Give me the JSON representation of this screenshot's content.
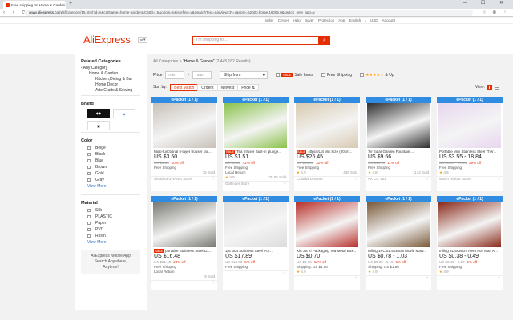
{
  "browser": {
    "tab_title": "Free shipping on Home & Garden",
    "url_host": "www.aliexpress.com",
    "url_rest": "/af/category/15.html?d=n&catName=home-garden&CatId=15&origin=n&isrefine=y&SearchText=&isViewCP=y&spm=a2g0o.home.16005.0&switch_new_app=y"
  },
  "topbar": {
    "links": "Seller Center    Help    Buyer Protection    App    English / USD    Account"
  },
  "header": {
    "logo": "AliExpress",
    "search_placeholder": "I'm shopping for..."
  },
  "sidebar": {
    "related_title": "Related Categories",
    "any_category": "Any Category",
    "home_garden": "Home & Garden",
    "sub1": "Kitchen,Dining & Bar",
    "sub2": "Home Decor",
    "sub3": "Arts,Crafts & Sewing",
    "brand_title": "Brand",
    "color_title": "Color",
    "colors": [
      "Beige",
      "Black",
      "Blue",
      "Brown",
      "Gold",
      "Gray"
    ],
    "view_more": "View More",
    "material_title": "Material",
    "materials": [
      "Silk",
      "PLASTIC",
      "Paper",
      "PVC",
      "Resin"
    ],
    "view_more2": "View More",
    "app_line1": "AliExpress Mobile App",
    "app_line2": "Search Anywhere,",
    "app_line3": "Anytime!"
  },
  "main": {
    "crumb_all": "All Categories",
    "crumb_sep": " > ",
    "crumb_cat": "\"Home & Garden\"",
    "crumb_count": " (2,445,162 Results)",
    "price_label": "Price",
    "min_placeholder": "min",
    "max_placeholder": "max",
    "ship_from": "Ship from",
    "sale_tag": "SALE",
    "sale_items": "Sale Items",
    "free_shipping": "Free Shipping",
    "and_up": "& Up",
    "sort_by": "Sort by:",
    "sort_best": "Best Match",
    "sort_orders": "Orders",
    "sort_newest": "Newest",
    "sort_price": "Price",
    "view_label": "View:"
  },
  "products": [
    {
      "badge": "ePacket (1 / 1)",
      "sale": false,
      "title": "Multi-functional 5-layer trouser rac...",
      "price": "US $3.50",
      "orig": "US $3.89",
      "off": "10% off",
      "ship": "Free Shipping",
      "local": "",
      "rating": "",
      "sold": "15 Sold",
      "store": "Shoebox-ZHANG Store",
      "sold2": "",
      "color": "#c8c0b8"
    },
    {
      "badge": "ePacket (1 / 1)",
      "sale": true,
      "title": "Tea Infuser Built-in plunge...",
      "price": "US $1.51",
      "orig": "US $2.61",
      "off": "42% off",
      "ship": "Free Shipping",
      "local": "Local Return",
      "rating": "4.9",
      "sold": "20105 Sold",
      "store": "Golfinder Store",
      "sold2": "",
      "color": "#8ac24a"
    },
    {
      "badge": "ePacket (1 / 1)",
      "sale": true,
      "title": "40pcs/Lot Mix Size (20cm...",
      "price": "US $26.45",
      "orig": "US $38.89",
      "off": "32% off",
      "ship": "Free Shipping",
      "local": "",
      "rating": "4.9",
      "sold": "439 Sold",
      "store": "Colorful Dreams",
      "sold2": "",
      "color": "#d8c9b0"
    },
    {
      "badge": "ePacket (1 / 1)",
      "sale": false,
      "title": "7V Solar Garden Fountain ...",
      "price": "US $9.66",
      "orig": "US $10.90",
      "off": "11% off",
      "ship": "Free Shipping",
      "local": "",
      "rating": "4.8",
      "sold": "1174 Sold",
      "store": "AK Co. Ltd",
      "sold2": "",
      "color": "#2e2e2e"
    },
    {
      "badge": "ePacket (1 / 1)",
      "sale": false,
      "title": "Portable Mini Stainless Steel Ther...",
      "price": "US $3.55 - 18.84",
      "orig": "US $5.00 - 26.54",
      "off": "29% off",
      "ship": "Free Shipping",
      "local": "",
      "rating": "4.8",
      "sold": "",
      "store": "Warm Harbor Store",
      "sold2": "",
      "color": "#e8d6f0"
    },
    {
      "badge": "ePacket (1 / 1)",
      "sale": true,
      "title": "portable Stainless Steel Lu...",
      "price": "US $16.48",
      "orig": "US $21.40",
      "off": "23% off",
      "ship": "Free Shipping",
      "local": "Local Return",
      "rating": "",
      "sold": "9 Sold",
      "store": "",
      "sold2": "",
      "color": "#7a7a72"
    },
    {
      "badge": "ePacket (1 / 1)",
      "sale": false,
      "title": "1pc 304 Stainless Steel Pot...",
      "price": "US $17.89",
      "orig": "US $18.83",
      "off": "5% off",
      "ship": "Free Shipping",
      "local": "",
      "rating": "",
      "sold": "",
      "store": "",
      "sold2": "",
      "color": "#dcdcdc"
    },
    {
      "badge": "ePacket (1 / 1)",
      "sale": false,
      "title": "Xin Jia Yi Packaging Tea Metal Box...",
      "price": "US $0.70",
      "orig": "US $0.80",
      "off": "12% off",
      "ship": "Shipping: US $1.96",
      "local": "",
      "rating": "4.9",
      "sold": "",
      "store": "",
      "sold2": "",
      "color": "#b8302a"
    },
    {
      "badge": "ePacket (1 / 1)",
      "sale": false,
      "title": "mlling 1PC 51.5x36cm Movie Marv...",
      "price": "US $0.78 - 1.03",
      "orig": "US $0.83 - 1.10",
      "off": "6% off",
      "ship": "Shipping: US $1.96",
      "local": "",
      "rating": "4.9",
      "sold": "",
      "store": "",
      "sold2": "",
      "color": "#7a5a3a"
    },
    {
      "badge": "ePacket (1 / 1)",
      "sale": false,
      "title": "mlling 51.5x36cm Hero Iron Man K...",
      "price": "US $0.38 - 0.49",
      "orig": "US $0.40 - 0.52",
      "off": "5% off",
      "ship": "Free Shipping",
      "local": "",
      "rating": "4.9",
      "sold": "",
      "store": "",
      "sold2": "",
      "color": "#8a2a1a"
    }
  ]
}
